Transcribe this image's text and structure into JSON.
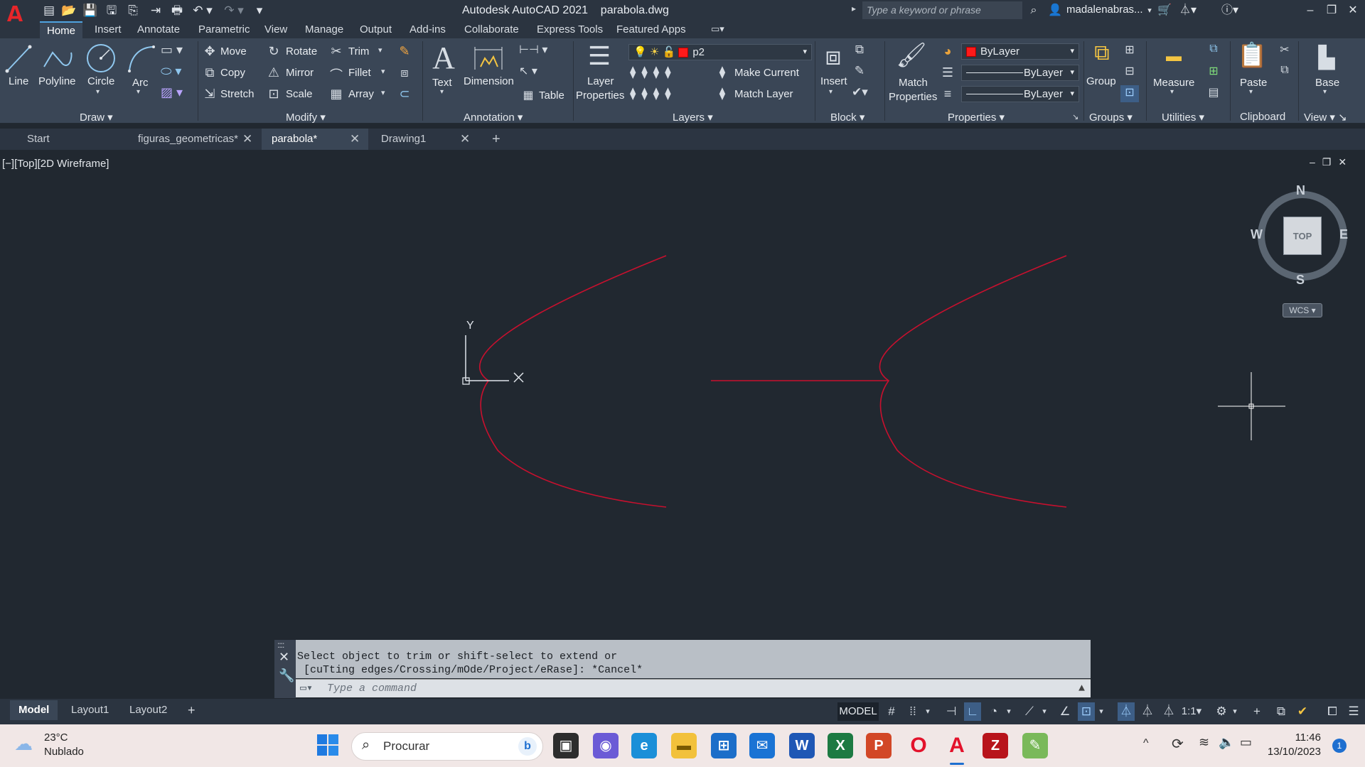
{
  "titlebar": {
    "app_name": "Autodesk AutoCAD 2021",
    "file_name": "parabola.dwg",
    "search_placeholder": "Type a keyword or phrase",
    "user": "madalenabras..."
  },
  "menu": {
    "tabs": [
      "Home",
      "Insert",
      "Annotate",
      "Parametric",
      "View",
      "Manage",
      "Output",
      "Add-ins",
      "Collaborate",
      "Express Tools",
      "Featured Apps"
    ],
    "active": "Home"
  },
  "ribbon": {
    "draw": {
      "title": "Draw",
      "line": "Line",
      "polyline": "Polyline",
      "circle": "Circle",
      "arc": "Arc"
    },
    "modify": {
      "title": "Modify",
      "move": "Move",
      "rotate": "Rotate",
      "trim": "Trim",
      "copy": "Copy",
      "mirror": "Mirror",
      "fillet": "Fillet",
      "stretch": "Stretch",
      "scale": "Scale",
      "array": "Array"
    },
    "annotation": {
      "title": "Annotation",
      "text": "Text",
      "dimension": "Dimension",
      "table": "Table"
    },
    "layers": {
      "title": "Layers",
      "layer_properties_1": "Layer",
      "layer_properties_2": "Properties",
      "current_layer": "p2",
      "make_current": "Make Current",
      "match_layer": "Match Layer"
    },
    "block": {
      "title": "Block",
      "insert": "Insert"
    },
    "properties": {
      "title": "Properties",
      "match_1": "Match",
      "match_2": "Properties",
      "color": "ByLayer",
      "linetype": "ByLayer",
      "lineweight": "ByLayer"
    },
    "groups": {
      "title": "Groups",
      "group": "Group"
    },
    "utilities": {
      "title": "Utilities",
      "measure": "Measure"
    },
    "clipboard": {
      "title": "Clipboard",
      "paste": "Paste"
    },
    "view": {
      "title": "View",
      "base": "Base"
    }
  },
  "doc_tabs": [
    {
      "label": "Start"
    },
    {
      "label": "figuras_geometricas*"
    },
    {
      "label": "parabola*"
    },
    {
      "label": "Drawing1"
    }
  ],
  "viewport": {
    "label": "[−][Top][2D Wireframe]",
    "ucs_y": "Y",
    "viewcube": {
      "n": "N",
      "s": "S",
      "e": "E",
      "w": "W",
      "top": "TOP",
      "wcs": "WCS"
    },
    "colors": {
      "curve": "#c8102e",
      "background": "#212830"
    }
  },
  "command": {
    "history_line1": "Select object to trim or shift-select to extend or",
    "history_line2": " [cuTting edges/Crossing/mOde/Project/eRase]: *Cancel*",
    "placeholder": "Type a command"
  },
  "layout_tabs": [
    "Model",
    "Layout1",
    "Layout2"
  ],
  "status": {
    "model": "MODEL",
    "scale": "1:1"
  },
  "taskbar": {
    "weather_temp": "23°C",
    "weather_text": "Nublado",
    "search": "Procurar",
    "time": "11:46",
    "date": "13/10/2023",
    "notifications": "1"
  }
}
